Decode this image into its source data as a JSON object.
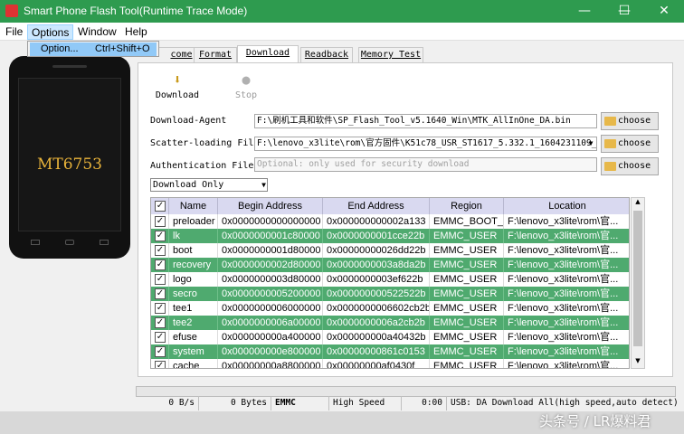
{
  "window": {
    "title": "Smart Phone Flash Tool(Runtime Trace Mode)",
    "minimize": "—",
    "maximize": "☐",
    "close": "✕"
  },
  "menu": {
    "file": "File",
    "options": "Options",
    "window": "Window",
    "help": "Help"
  },
  "options_menu": {
    "item_label": "Option...",
    "item_shortcut": "Ctrl+Shift+O"
  },
  "device": {
    "chip": "MT6753"
  },
  "tabs": [
    "Welcome",
    "Format",
    "Download",
    "Readback",
    "Memory Test"
  ],
  "tabs_visible": [
    "come",
    "Format",
    "Download",
    "Readback",
    "Memory Test"
  ],
  "toolbar": {
    "download": "Download",
    "stop": "Stop"
  },
  "fields": {
    "download_agent_label": "Download-Agent",
    "download_agent_value": "F:\\刷机工具和软件\\SP_Flash_Tool_v5.1640_Win\\MTK_AllInOne_DA.bin",
    "scatter_label": "Scatter-loading File",
    "scatter_value": "F:\\lenovo_x3lite\\rom\\官方固件\\K51c78_USR_ST1617_5.332.1_1604231109_",
    "auth_label": "Authentication File",
    "auth_placeholder": "Optional: only used for security download",
    "choose_label": "choose"
  },
  "mode": {
    "selected": "Download Only"
  },
  "table": {
    "headers": [
      "Name",
      "Begin Address",
      "End Address",
      "Region",
      "Location"
    ],
    "rows": [
      {
        "name": "preloader",
        "begin": "0x0000000000000000",
        "end": "0x000000000002a133",
        "region": "EMMC_BOOT_1",
        "location": "F:\\lenovo_x3lite\\rom\\官..."
      },
      {
        "name": "lk",
        "begin": "0x0000000001c80000",
        "end": "0x0000000001cce22b",
        "region": "EMMC_USER",
        "location": "F:\\lenovo_x3lite\\rom\\官..."
      },
      {
        "name": "boot",
        "begin": "0x0000000001d80000",
        "end": "0x00000000026dd22b",
        "region": "EMMC_USER",
        "location": "F:\\lenovo_x3lite\\rom\\官..."
      },
      {
        "name": "recovery",
        "begin": "0x0000000002d80000",
        "end": "0x0000000003a8da2b",
        "region": "EMMC_USER",
        "location": "F:\\lenovo_x3lite\\rom\\官..."
      },
      {
        "name": "logo",
        "begin": "0x0000000003d80000",
        "end": "0x0000000003ef622b",
        "region": "EMMC_USER",
        "location": "F:\\lenovo_x3lite\\rom\\官..."
      },
      {
        "name": "secro",
        "begin": "0x0000000005200000",
        "end": "0x000000000522522b",
        "region": "EMMC_USER",
        "location": "F:\\lenovo_x3lite\\rom\\官..."
      },
      {
        "name": "tee1",
        "begin": "0x0000000006000000",
        "end": "0x0000000006602cb2b",
        "region": "EMMC_USER",
        "location": "F:\\lenovo_x3lite\\rom\\官..."
      },
      {
        "name": "tee2",
        "begin": "0x0000000006a00000",
        "end": "0x0000000006a2cb2b",
        "region": "EMMC_USER",
        "location": "F:\\lenovo_x3lite\\rom\\官..."
      },
      {
        "name": "efuse",
        "begin": "0x000000000a400000",
        "end": "0x000000000a40432b",
        "region": "EMMC_USER",
        "location": "F:\\lenovo_x3lite\\rom\\官..."
      },
      {
        "name": "system",
        "begin": "0x000000000e800000",
        "end": "0x00000000861c0153",
        "region": "EMMC_USER",
        "location": "F:\\lenovo_x3lite\\rom\\官..."
      },
      {
        "name": "cache",
        "begin": "0x00000000a8800000",
        "end": "0x00000000af0430f",
        "region": "EMMC_USER",
        "location": "F:\\lenovo_x3lite\\rom\\官..."
      }
    ]
  },
  "status": {
    "speed": "0 B/s",
    "bytes": "0 Bytes",
    "storage": "EMMC",
    "usb_speed": "High Speed",
    "time": "0:00",
    "usb_mode": "USB: DA Download All(high speed,auto detect)"
  },
  "watermark": "头条号 / LR爆料君",
  "colors": {
    "titlebar": "#2e9b4f",
    "row_highlight": "#4faa6f"
  }
}
